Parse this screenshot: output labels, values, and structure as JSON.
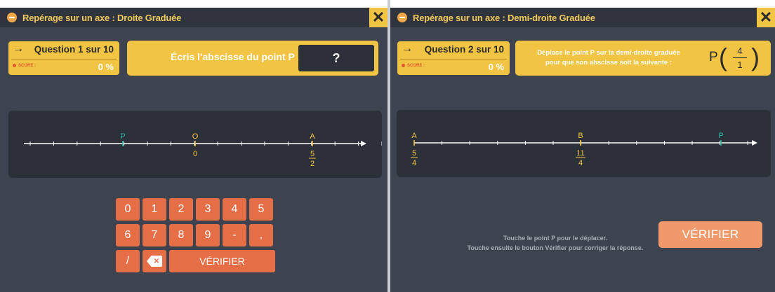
{
  "left": {
    "title": "Repérage sur un axe : Droite Graduée",
    "close": "✕",
    "question": {
      "arrow": "→",
      "label": "Question 1 sur 10",
      "score_label": "SCORE :",
      "score": "0 %"
    },
    "instruction": "Écris l'abscisse du point P :",
    "answer": "?",
    "axis": {
      "type": "Droite Graduée",
      "ticks": 16,
      "points": [
        {
          "name": "P",
          "tick": 4,
          "color": "#2bb7a3"
        },
        {
          "name": "O",
          "tick": 7,
          "value": "0",
          "color": "#f2c443"
        },
        {
          "name": "A",
          "tick": 12,
          "numerator": "5",
          "denominator": "2",
          "color": "#f2c443"
        }
      ]
    },
    "keypad": {
      "row1": [
        "0",
        "1",
        "2",
        "3",
        "4",
        "5"
      ],
      "row2": [
        "6",
        "7",
        "8",
        "9",
        "-",
        ","
      ],
      "row3": [
        "/",
        "⌫"
      ],
      "verify": "VÉRIFIER"
    }
  },
  "right": {
    "title": "Repérage sur un axe : Demi-droite Graduée",
    "close": "✕",
    "question": {
      "arrow": "→",
      "label": "Question 2 sur 10",
      "score_label": "SCORE :",
      "score": "0 %"
    },
    "instruction_line1": "Déplace le point P sur la demi-droite graduée",
    "instruction_line2": "pour que son abscisse soit la suivante :",
    "target": {
      "point": "P",
      "numerator": "4",
      "denominator": "1"
    },
    "axis": {
      "type": "Demi-droite Graduée",
      "ticks": 14,
      "points": [
        {
          "name": "A",
          "tick": 0,
          "numerator": "5",
          "denominator": "4",
          "color": "#f2c443"
        },
        {
          "name": "B",
          "tick": 6,
          "numerator": "11",
          "denominator": "4",
          "color": "#f2c443"
        },
        {
          "name": "P",
          "tick": 12,
          "color": "#2bb7a3"
        }
      ]
    },
    "hint_line1": "Touche le point P pour le déplacer.",
    "hint_line2": "Touche ensuite le bouton Vérifier pour corriger la réponse.",
    "verify": "VÉRIFIER"
  },
  "colors": {
    "panel": "#3d4450",
    "titlebar": "#2f343d",
    "accent": "#f2c443",
    "key": "#e66e47",
    "teal": "#2bb7a3"
  }
}
